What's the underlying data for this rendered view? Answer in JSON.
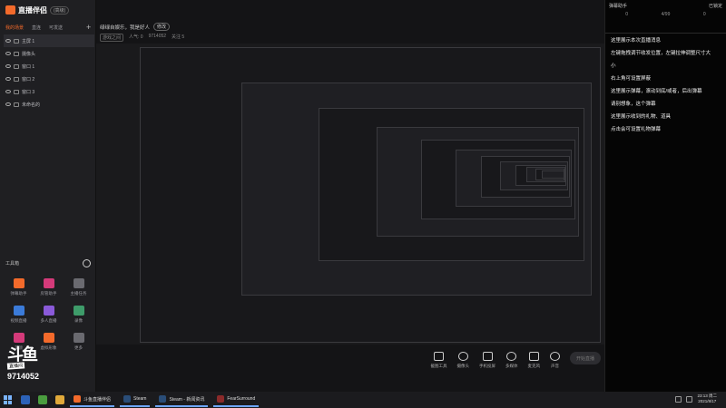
{
  "app": {
    "name": "直播伴侣",
    "version": "(高级)"
  },
  "sidebar": {
    "tabs": [
      "我的场景",
      "直连",
      "可发送"
    ],
    "add_scene": "+",
    "scenes": [
      {
        "label": "主屏 1"
      },
      {
        "label": "摄像头"
      },
      {
        "label": "窗口 1"
      },
      {
        "label": "窗口 2"
      },
      {
        "label": "窗口 3"
      },
      {
        "label": "未命名的"
      }
    ],
    "tools_title": "工具箱",
    "tools": [
      {
        "label": "弹幕助手",
        "icon": "danmaku-icon",
        "color": "#f36a2b"
      },
      {
        "label": "房管助手",
        "icon": "admin-icon",
        "color": "#d43a7a"
      },
      {
        "label": "主播任务",
        "icon": "task-icon",
        "color": "#6a6a70"
      },
      {
        "label": "视频直播",
        "icon": "video-icon",
        "color": "#3b7bd9"
      },
      {
        "label": "多人直播",
        "icon": "multi-icon",
        "color": "#8a5ad9"
      },
      {
        "label": "录像",
        "icon": "record-icon",
        "color": "#3e9c6a"
      },
      {
        "label": "美颜",
        "icon": "beauty-icon",
        "color": "#d43a7a"
      },
      {
        "label": "虚拟形象",
        "icon": "avatar-icon",
        "color": "#f36a2b"
      },
      {
        "label": "更多",
        "icon": "more-icon",
        "color": "#6a6a70"
      }
    ],
    "douyu_text": "斗鱼",
    "douyu_sub": "直播间",
    "room_number": "9714052"
  },
  "main": {
    "room_title": "绿绿自娱乐，我是好人",
    "modify_label": "修改",
    "category": "游戏之间",
    "hot": "人气: 0",
    "room_id": "9714052",
    "followers": "关注 5"
  },
  "bottom_bar": [
    {
      "label": "截图工具",
      "icon": "screen-share-icon"
    },
    {
      "label": "摄像头",
      "icon": "camera-icon"
    },
    {
      "label": "手机投屏",
      "icon": "phone-cast-icon"
    },
    {
      "label": "多媒体",
      "icon": "media-icon"
    },
    {
      "label": "麦克风",
      "icon": "mic-icon"
    },
    {
      "label": "声音",
      "icon": "speaker-icon"
    }
  ],
  "start_live_label": "开始直播",
  "chat": {
    "header_left": "弹幕助手",
    "header_right": "已锁定",
    "stats": [
      "0",
      "4/99",
      "0"
    ],
    "messages": [
      "这里展示本次直播消息",
      "左键拖拽调节收发位置，左键拉伸调整尺寸大",
      "小",
      "右上角可设置屏蔽",
      "这里展示弹幕，滚动到底/或者，后出弹幕",
      "请别想象，这个弹幕",
      "这里展示收到的礼物、道具",
      "点击会可设置礼物弹幕"
    ]
  },
  "taskbar": {
    "tasks": [
      {
        "label": "斗鱼直播伴侣",
        "color": "#f36a2b"
      },
      {
        "label": "Steam",
        "color": "#2a4d78"
      },
      {
        "label": "Steam - 新闻资讯",
        "color": "#2a4d78"
      },
      {
        "label": "FearSurround",
        "color": "#8b2a2a"
      }
    ],
    "time": "23:13 周二",
    "date": "2021/8/17"
  }
}
